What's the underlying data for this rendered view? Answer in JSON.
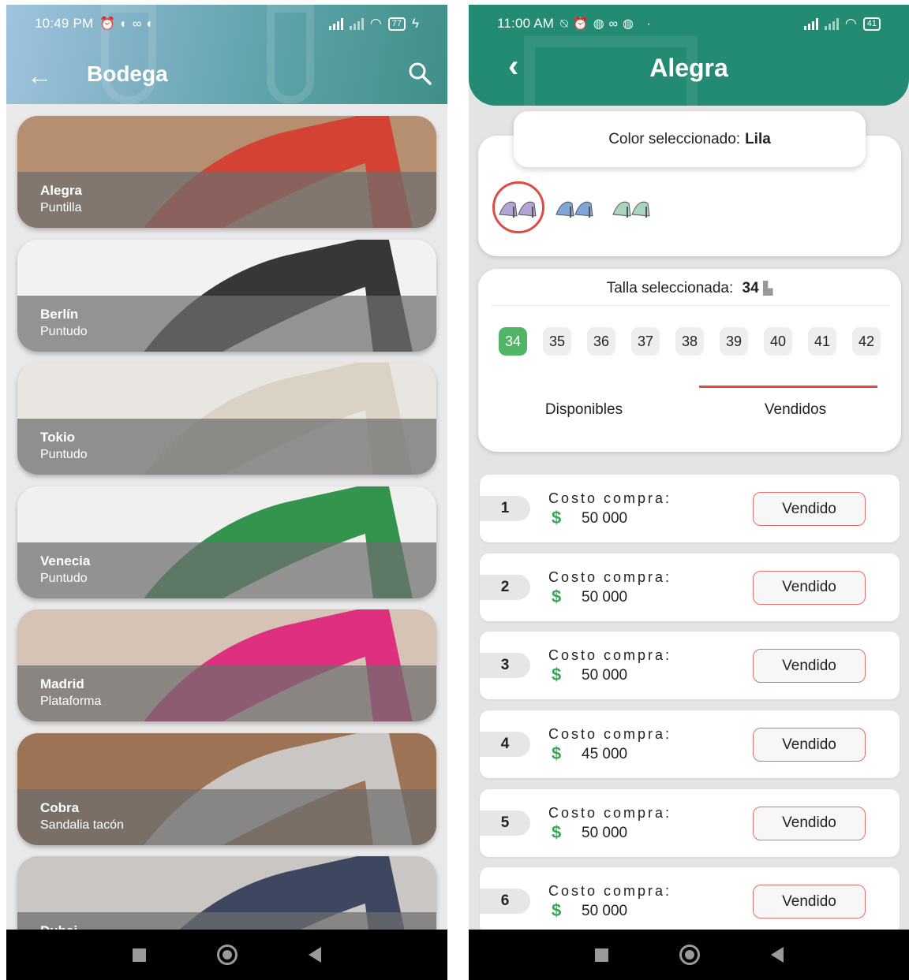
{
  "left": {
    "status": {
      "time": "10:49 PM",
      "battery": "77"
    },
    "header": {
      "title": "Bodega"
    },
    "products": [
      {
        "name": "Alegra",
        "category": "Puntilla",
        "bg": "#b58f6f",
        "accent": "#d73a2e"
      },
      {
        "name": "Berlín",
        "category": "Puntudo",
        "bg": "#f2f2f2",
        "accent": "#222222"
      },
      {
        "name": "Tokio",
        "category": "Puntudo",
        "bg": "#e9e6e1",
        "accent": "#d8d0c2"
      },
      {
        "name": "Venecia",
        "category": "Puntudo",
        "bg": "#f0f0ee",
        "accent": "#1e8a3c"
      },
      {
        "name": "Madrid",
        "category": "Plataforma",
        "bg": "#d6c3b6",
        "accent": "#e0207a"
      },
      {
        "name": "Cobra",
        "category": "Sandalia tacón",
        "bg": "#9c7355",
        "accent": "#cfcfcf"
      },
      {
        "name": "Dubai",
        "category": "",
        "bg": "#c9c6c3",
        "accent": "#2d3a55"
      }
    ]
  },
  "right": {
    "status": {
      "time": "11:00 AM",
      "battery": "41"
    },
    "header": {
      "title": "Alegra"
    },
    "color_label": "Color seleccionado: ",
    "color_value": "Lila",
    "swatches": [
      {
        "name": "lila",
        "color": "#b6a3d6"
      },
      {
        "name": "azul",
        "color": "#7fa6d8"
      },
      {
        "name": "verde",
        "color": "#a9d4bd"
      }
    ],
    "size_label": "Talla seleccionada: ",
    "size_value": "34",
    "sizes": [
      "34",
      "35",
      "36",
      "37",
      "38",
      "39",
      "40",
      "41",
      "42"
    ],
    "tabs": {
      "available": "Disponibles",
      "sold": "Vendidos"
    },
    "sold": [
      {
        "num": "1",
        "label": "Costo compra:",
        "price": "50 000",
        "button": "Vendido"
      },
      {
        "num": "2",
        "label": "Costo compra:",
        "price": "50 000",
        "button": "Vendido"
      },
      {
        "num": "3",
        "label": "Costo compra:",
        "price": "50 000",
        "button": "Vendido"
      },
      {
        "num": "4",
        "label": "Costo compra:",
        "price": "45 000",
        "button": "Vendido"
      },
      {
        "num": "5",
        "label": "Costo compra:",
        "price": "50 000",
        "button": "Vendido"
      },
      {
        "num": "6",
        "label": "Costo compra:",
        "price": "50 000",
        "button": "Vendido"
      }
    ]
  },
  "colors": {
    "teal": "#238a73",
    "green": "#52b466",
    "red": "#e04a44",
    "dollar": "#3aa757"
  }
}
